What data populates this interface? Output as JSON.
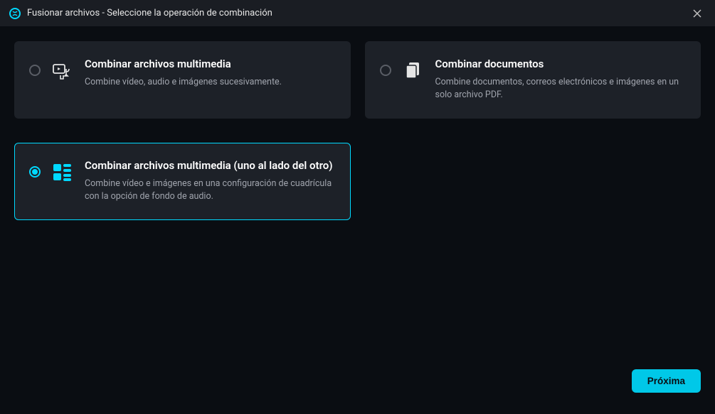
{
  "title": "Fusionar archivos - Seleccione la operación de combinación",
  "options": {
    "multimedia": {
      "title": "Combinar archivos multimedia",
      "desc": "Combine vídeo, audio e imágenes sucesivamente."
    },
    "documents": {
      "title": "Combinar documentos",
      "desc": "Combine documentos, correos electrónicos e imágenes en un solo archivo PDF."
    },
    "sidebyside": {
      "title": "Combinar archivos multimedia (uno al lado del otro)",
      "desc": "Combine vídeo e imágenes en una configuración de cuadrícula con la opción de fondo de audio."
    }
  },
  "buttons": {
    "next": "Próxima"
  }
}
